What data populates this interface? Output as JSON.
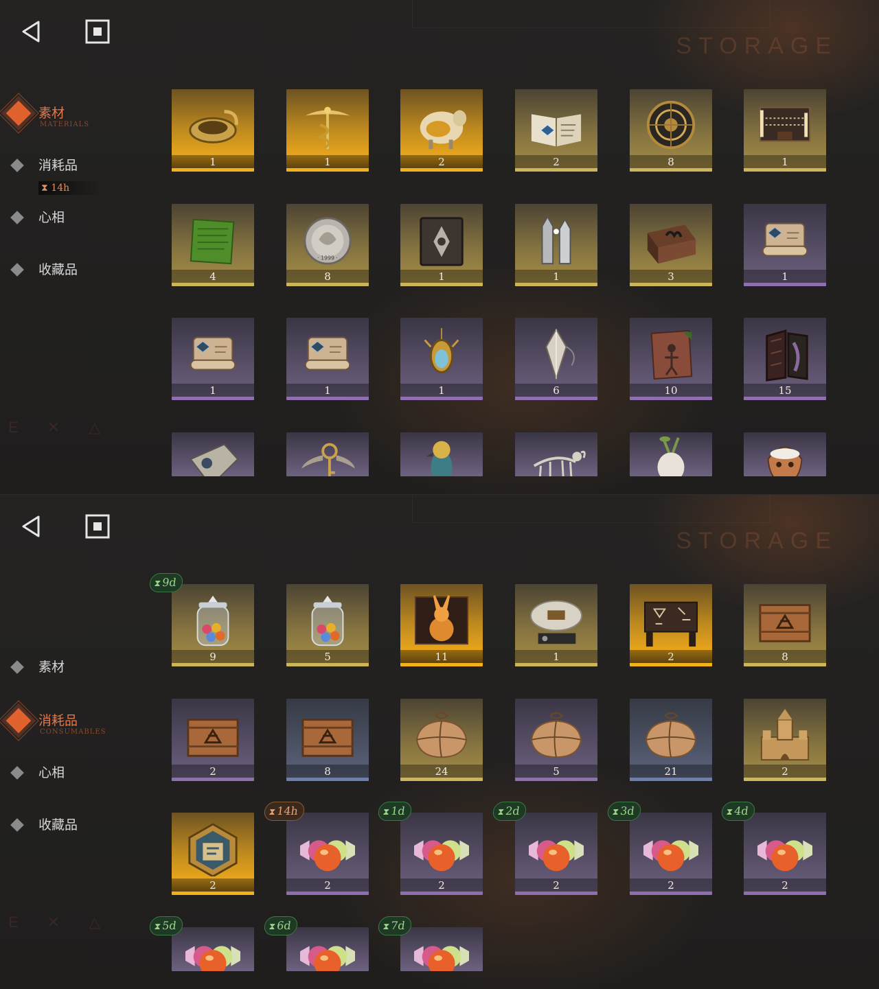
{
  "colors": {
    "accent": "#e0622e",
    "gold": "#f1b21a",
    "purple": "#8f6fb0",
    "timer_green": "#9bd48a",
    "timer_orange": "#e8a070"
  },
  "header": {
    "title": "STORAGE",
    "back_icon": "back-triangle-icon",
    "home_icon": "home-square-icon"
  },
  "screens": [
    {
      "active": "materials",
      "nav": [
        {
          "id": "materials",
          "label": "素材",
          "sub": "MATERIALS",
          "active": true
        },
        {
          "id": "consumables",
          "label": "消耗品",
          "sub": "",
          "active": false,
          "timer": "14h"
        },
        {
          "id": "mindset",
          "label": "心相",
          "sub": "",
          "active": false
        },
        {
          "id": "collectibles",
          "label": "收藏品",
          "sub": "",
          "active": false
        }
      ],
      "rows": [
        [
          {
            "name": "ornate-ring-item",
            "count": "1",
            "rarity": "gold",
            "art": "ring"
          },
          {
            "name": "caduceus-item",
            "count": "1",
            "rarity": "gold",
            "art": "caduceus"
          },
          {
            "name": "golden-sheep-item",
            "count": "2",
            "rarity": "gold",
            "art": "sheep"
          },
          {
            "name": "open-book-item",
            "count": "2",
            "rarity": "yellow",
            "art": "book"
          },
          {
            "name": "astrolabe-item",
            "count": "8",
            "rarity": "yellow",
            "art": "astrolabe"
          },
          {
            "name": "ouija-board-item",
            "count": "1",
            "rarity": "yellow",
            "art": "ouija"
          }
        ],
        [
          {
            "name": "green-tablet-item",
            "count": "4",
            "rarity": "yellow",
            "art": "tablet"
          },
          {
            "name": "silver-coin-item",
            "count": "8",
            "rarity": "yellow",
            "art": "coin"
          },
          {
            "name": "dark-tome-item",
            "count": "1",
            "rarity": "yellow",
            "art": "tome"
          },
          {
            "name": "silver-bullets-item",
            "count": "1",
            "rarity": "yellow",
            "art": "bullets"
          },
          {
            "name": "hand-box-item",
            "count": "3",
            "rarity": "yellow",
            "art": "box"
          },
          {
            "name": "green-scroll-item",
            "count": "1",
            "rarity": "purple",
            "art": "scroll"
          }
        ],
        [
          {
            "name": "blue-scroll-item",
            "count": "1",
            "rarity": "purple",
            "art": "scroll"
          },
          {
            "name": "gold-scroll-item",
            "count": "1",
            "rarity": "purple",
            "art": "scroll"
          },
          {
            "name": "beetle-amulet-item",
            "count": "1",
            "rarity": "purple",
            "art": "amulet"
          },
          {
            "name": "crystal-pendulum-item",
            "count": "6",
            "rarity": "purple",
            "art": "pendulum"
          },
          {
            "name": "stone-carving-item",
            "count": "10",
            "rarity": "purple",
            "art": "stone"
          },
          {
            "name": "frame-feather-item",
            "count": "15",
            "rarity": "purple",
            "art": "frame"
          }
        ],
        [
          {
            "name": "metal-shield-item",
            "count": "",
            "rarity": "purple",
            "art": "shield"
          },
          {
            "name": "winged-key-item",
            "count": "",
            "rarity": "purple",
            "art": "key"
          },
          {
            "name": "bird-figurine-item",
            "count": "",
            "rarity": "purple",
            "art": "bird"
          },
          {
            "name": "ram-skeleton-item",
            "count": "",
            "rarity": "purple",
            "art": "skeleton"
          },
          {
            "name": "mandrake-item",
            "count": "",
            "rarity": "purple",
            "art": "mandrake"
          },
          {
            "name": "mask-item",
            "count": "",
            "rarity": "purple",
            "art": "mask"
          }
        ]
      ]
    },
    {
      "active": "consumables",
      "nav": [
        {
          "id": "materials",
          "label": "素材",
          "sub": "",
          "active": false
        },
        {
          "id": "consumables",
          "label": "消耗品",
          "sub": "CONSUMABLES",
          "active": true
        },
        {
          "id": "mindset",
          "label": "心相",
          "sub": "",
          "active": false
        },
        {
          "id": "collectibles",
          "label": "收藏品",
          "sub": "",
          "active": false
        }
      ],
      "rows": [
        [
          {
            "name": "candy-jar-item",
            "count": "9",
            "rarity": "yellow",
            "art": "jar",
            "timer": "9d",
            "timer_color": "green"
          },
          {
            "name": "candy-jar-item",
            "count": "5",
            "rarity": "yellow",
            "art": "jar"
          },
          {
            "name": "glowing-rabbit-box-item",
            "count": "11",
            "rarity": "gold",
            "art": "rabbit"
          },
          {
            "name": "radio-device-item",
            "count": "1",
            "rarity": "yellow",
            "art": "radio"
          },
          {
            "name": "rune-table-item",
            "count": "2",
            "rarity": "gold",
            "art": "table"
          },
          {
            "name": "wooden-crate-item",
            "count": "8",
            "rarity": "yellow",
            "art": "crate"
          }
        ],
        [
          {
            "name": "wooden-crate-item",
            "count": "2",
            "rarity": "purple",
            "art": "crate"
          },
          {
            "name": "wooden-crate-item",
            "count": "8",
            "rarity": "blue",
            "art": "crate"
          },
          {
            "name": "paper-parcel-item",
            "count": "24",
            "rarity": "yellow",
            "art": "parcel"
          },
          {
            "name": "paper-parcel-item",
            "count": "5",
            "rarity": "purple",
            "art": "parcel"
          },
          {
            "name": "paper-parcel-item",
            "count": "21",
            "rarity": "blue",
            "art": "parcel"
          },
          {
            "name": "sand-castle-item",
            "count": "2",
            "rarity": "yellow",
            "art": "castle"
          }
        ],
        [
          {
            "name": "hexagon-puzzle-item",
            "count": "2",
            "rarity": "gold",
            "art": "hexagon"
          },
          {
            "name": "candy-item",
            "count": "2",
            "rarity": "purple",
            "art": "candy",
            "timer": "14h",
            "timer_color": "orange"
          },
          {
            "name": "candy-item",
            "count": "2",
            "rarity": "purple",
            "art": "candy",
            "timer": "1d",
            "timer_color": "green"
          },
          {
            "name": "candy-item",
            "count": "2",
            "rarity": "purple",
            "art": "candy",
            "timer": "2d",
            "timer_color": "green"
          },
          {
            "name": "candy-item",
            "count": "2",
            "rarity": "purple",
            "art": "candy",
            "timer": "3d",
            "timer_color": "green"
          },
          {
            "name": "candy-item",
            "count": "2",
            "rarity": "purple",
            "art": "candy",
            "timer": "4d",
            "timer_color": "green"
          }
        ],
        [
          {
            "name": "candy-item",
            "count": "",
            "rarity": "purple",
            "art": "candy",
            "timer": "5d",
            "timer_color": "green"
          },
          {
            "name": "candy-item",
            "count": "",
            "rarity": "purple",
            "art": "candy",
            "timer": "6d",
            "timer_color": "green"
          },
          {
            "name": "candy-item",
            "count": "",
            "rarity": "purple",
            "art": "candy",
            "timer": "7d",
            "timer_color": "green"
          }
        ]
      ]
    }
  ]
}
